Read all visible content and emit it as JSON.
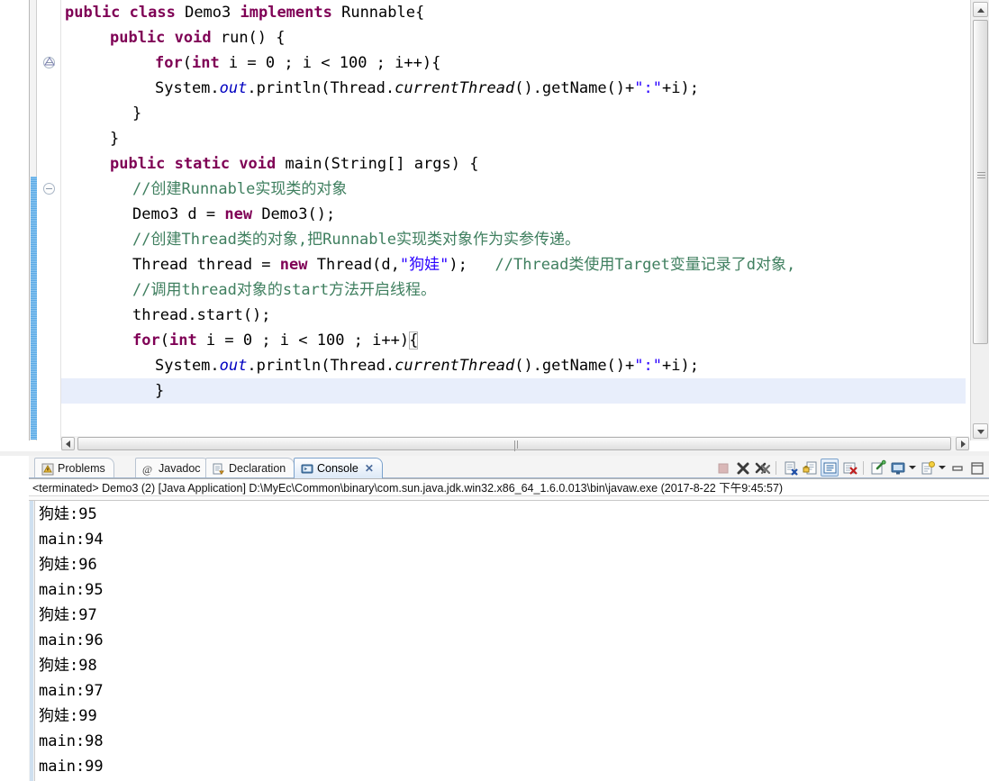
{
  "editor": {
    "lines": [
      {
        "indent": 0,
        "segments": [
          {
            "t": "public ",
            "c": "k"
          },
          {
            "t": "class ",
            "c": "k"
          },
          {
            "t": "Demo3 ",
            "c": ""
          },
          {
            "t": "implements ",
            "c": "k"
          },
          {
            "t": "Runnable{",
            "c": ""
          }
        ]
      },
      {
        "indent": 1,
        "segments": [
          {
            "t": "public ",
            "c": "k"
          },
          {
            "t": "void ",
            "c": "k"
          },
          {
            "t": "run() {",
            "c": ""
          }
        ]
      },
      {
        "indent": 2,
        "segments": [
          {
            "t": "for",
            "c": "k"
          },
          {
            "t": "(",
            "c": ""
          },
          {
            "t": "int",
            "c": "k"
          },
          {
            "t": " i = 0 ; i < 100 ; i++){",
            "c": ""
          }
        ]
      },
      {
        "indent": 2,
        "segments": [
          {
            "t": "System.",
            "c": ""
          },
          {
            "t": "out",
            "c": "fi"
          },
          {
            "t": ".println(Thread.",
            "c": ""
          },
          {
            "t": "currentThread",
            "c": "mi"
          },
          {
            "t": "().getName()+",
            "c": ""
          },
          {
            "t": "\":\"",
            "c": "st"
          },
          {
            "t": "+i);",
            "c": ""
          }
        ]
      },
      {
        "indent": 1.5,
        "segments": [
          {
            "t": "}",
            "c": ""
          }
        ]
      },
      {
        "indent": 1,
        "segments": [
          {
            "t": "}",
            "c": ""
          }
        ]
      },
      {
        "indent": 1,
        "segments": [
          {
            "t": "public ",
            "c": "k"
          },
          {
            "t": "static ",
            "c": "k"
          },
          {
            "t": "void ",
            "c": "k"
          },
          {
            "t": "main(String[] args) {",
            "c": ""
          }
        ]
      },
      {
        "indent": 1.5,
        "segments": [
          {
            "t": "//创建Runnable实现类的对象",
            "c": "cm"
          }
        ]
      },
      {
        "indent": 1.5,
        "segments": [
          {
            "t": "Demo3 d = ",
            "c": ""
          },
          {
            "t": "new",
            "c": "k"
          },
          {
            "t": " Demo3();",
            "c": ""
          }
        ]
      },
      {
        "indent": 1.5,
        "segments": [
          {
            "t": "//创建Thread类的对象,把Runnable实现类对象作为实参传递。",
            "c": "cm"
          }
        ]
      },
      {
        "indent": 1.5,
        "segments": [
          {
            "t": "Thread thread = ",
            "c": ""
          },
          {
            "t": "new",
            "c": "k"
          },
          {
            "t": " Thread(d,",
            "c": ""
          },
          {
            "t": "\"狗娃\"",
            "c": "st"
          },
          {
            "t": ");   ",
            "c": ""
          },
          {
            "t": "//Thread类使用Target变量记录了d对象,",
            "c": "cm"
          }
        ]
      },
      {
        "indent": 1.5,
        "segments": [
          {
            "t": "//调用thread对象的start方法开启线程。",
            "c": "cm"
          }
        ]
      },
      {
        "indent": 1.5,
        "segments": [
          {
            "t": "thread.start();",
            "c": ""
          }
        ]
      },
      {
        "indent": 1.5,
        "segments": [
          {
            "t": "for",
            "c": "k"
          },
          {
            "t": "(",
            "c": ""
          },
          {
            "t": "int",
            "c": "k"
          },
          {
            "t": " i = 0 ; i < 100 ; i++)",
            "c": ""
          },
          {
            "t": "{",
            "c": "brk"
          }
        ]
      },
      {
        "indent": 2,
        "segments": [
          {
            "t": "System.",
            "c": ""
          },
          {
            "t": "out",
            "c": "fi"
          },
          {
            "t": ".println(Thread.",
            "c": ""
          },
          {
            "t": "currentThread",
            "c": "mi"
          },
          {
            "t": "().getName()+",
            "c": ""
          },
          {
            "t": "\":\"",
            "c": "st"
          },
          {
            "t": "+i);",
            "c": ""
          }
        ]
      },
      {
        "indent": 2,
        "segments": [
          {
            "t": "}",
            "c": ""
          }
        ],
        "highlight": true
      }
    ]
  },
  "tabs": [
    {
      "label": "Problems",
      "icon": "problems-icon",
      "active": false,
      "closable": false
    },
    {
      "label": "Javadoc",
      "icon": "javadoc-icon",
      "active": false,
      "closable": false
    },
    {
      "label": "Declaration",
      "icon": "declaration-icon",
      "active": false,
      "closable": false
    },
    {
      "label": "Console",
      "icon": "console-icon",
      "active": true,
      "closable": true
    }
  ],
  "tab_close_glyph": "✕",
  "toolbar": {
    "buttons": [
      {
        "name": "terminate-button",
        "tip": "Terminate",
        "disabled": true,
        "pressed": false
      },
      {
        "name": "remove-launch-button",
        "tip": "Remove Launch",
        "disabled": false,
        "pressed": false
      },
      {
        "name": "remove-all-terminated-button",
        "tip": "Remove All Terminated",
        "disabled": false,
        "pressed": false
      },
      {
        "name": "clear-console-button",
        "tip": "Clear Console",
        "disabled": false,
        "pressed": false
      },
      {
        "name": "scroll-lock-button",
        "tip": "Scroll Lock",
        "disabled": false,
        "pressed": false
      },
      {
        "name": "show-console-on-output-button",
        "tip": "Show Console When Output Changes",
        "disabled": false,
        "pressed": true
      },
      {
        "name": "show-console-on-error-button",
        "tip": "Show Console When Error",
        "disabled": false,
        "pressed": false
      },
      {
        "name": "pin-console-button",
        "tip": "Pin Console",
        "disabled": false,
        "pressed": false
      },
      {
        "name": "display-selected-console-button",
        "tip": "Display Selected Console",
        "disabled": false,
        "pressed": false
      },
      {
        "name": "open-console-button",
        "tip": "Open Console",
        "disabled": false,
        "pressed": false
      },
      {
        "name": "minimize-button",
        "tip": "Minimize",
        "disabled": false,
        "pressed": false
      },
      {
        "name": "maximize-button",
        "tip": "Maximize",
        "disabled": false,
        "pressed": false
      }
    ]
  },
  "console": {
    "launch_header": "<terminated> Demo3 (2) [Java Application] D:\\MyEc\\Common\\binary\\com.sun.java.jdk.win32.x86_64_1.6.0.013\\bin\\javaw.exe (2017-8-22 下午9:45:57)",
    "output": [
      "狗娃:95",
      "main:94",
      "狗娃:96",
      "main:95",
      "狗娃:97",
      "main:96",
      "狗娃:98",
      "main:97",
      "狗娃:99",
      "main:98",
      "main:99"
    ]
  },
  "colors": {
    "keyword": "#7F0055",
    "comment": "#3F7F5F",
    "string": "#2A00FF",
    "static_field": "#0000C0",
    "line_highlight": "#E8EEFB",
    "change_bar": "#5AA9E6",
    "active_tab": "#DCE9F7"
  }
}
